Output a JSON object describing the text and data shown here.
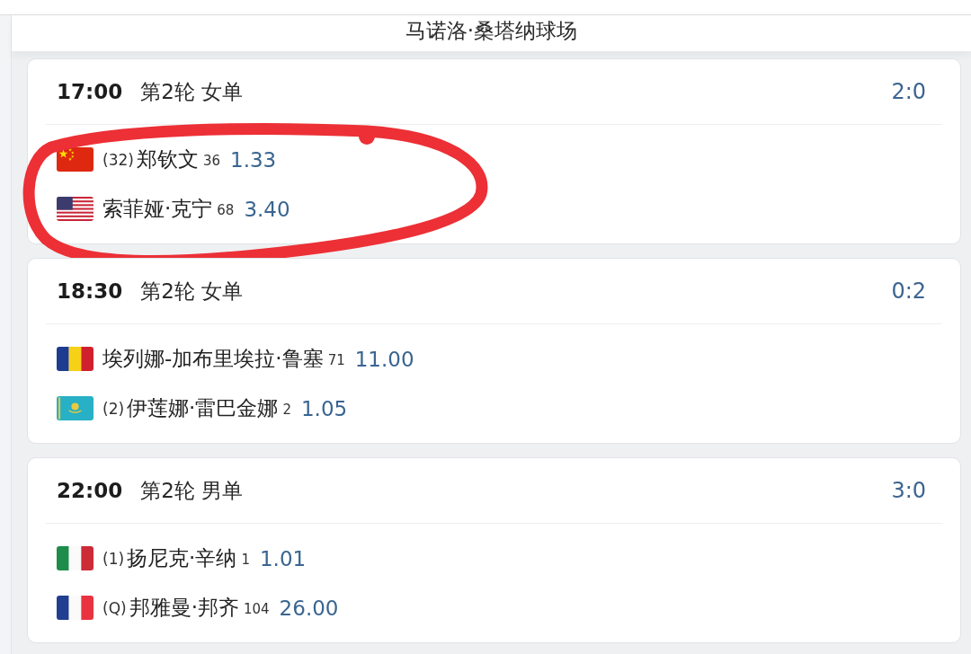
{
  "venue": {
    "title": "马诺洛·桑塔纳球场"
  },
  "matches": [
    {
      "time": "17:00",
      "round": "第2轮 女单",
      "score": "2:0",
      "circled": true,
      "players": [
        {
          "kind": "cn",
          "seed": "(32)",
          "name": "郑钦文",
          "rank": "36",
          "odds": "1.33"
        },
        {
          "kind": "us",
          "name": "索菲娅·克宁",
          "rank": "68",
          "odds": "3.40"
        }
      ]
    },
    {
      "time": "18:30",
      "round": "第2轮 女单",
      "score": "0:2",
      "circled": false,
      "players": [
        {
          "kind": "ro",
          "name": "埃列娜-加布里埃拉·鲁塞",
          "rank": "71",
          "odds": "11.00"
        },
        {
          "kind": "kz",
          "seed": "(2)",
          "name": "伊莲娜·雷巴金娜",
          "rank": "2",
          "odds": "1.05"
        }
      ]
    },
    {
      "time": "22:00",
      "round": "第2轮 男单",
      "score": "3:0",
      "circled": false,
      "players": [
        {
          "kind": "it",
          "seed": "(1)",
          "name": "扬尼克·辛纳",
          "rank": "1",
          "odds": "1.01"
        },
        {
          "kind": "fr",
          "seed": "(Q)",
          "name": "邦雅曼·邦齐",
          "rank": "104",
          "odds": "26.00"
        }
      ]
    }
  ]
}
